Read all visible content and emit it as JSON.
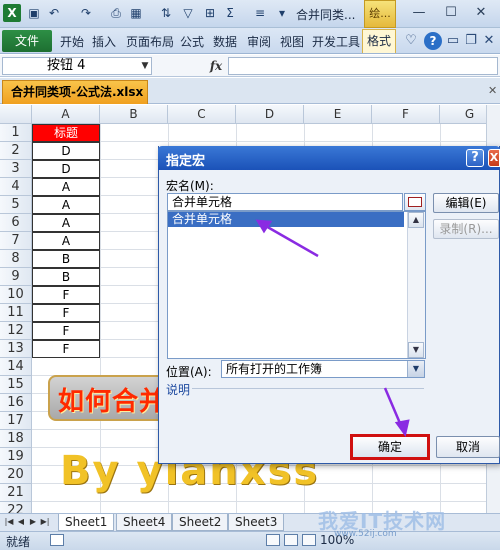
{
  "title_bar": {
    "app_icon": "X",
    "title": "合并同类...",
    "context_tab_title": "绘...",
    "quick_access_icons": [
      "save-icon",
      "undo-icon",
      "redo-icon",
      "print-preview-icon",
      "form-icon",
      "sort-icon",
      "border-icon",
      "sum-icon",
      "align-icon"
    ]
  },
  "ribbon": {
    "file_tab": "文件",
    "tabs": [
      "开始",
      "插入",
      "页面布局",
      "公式",
      "数据",
      "审阅",
      "视图",
      "开发工具"
    ],
    "context_tab": "格式"
  },
  "formula_bar": {
    "name_box": "按钮 4",
    "fx": "fx",
    "formula": ""
  },
  "workbook": {
    "tab_label": "合并同类项-公式法.xlsx"
  },
  "grid": {
    "columns": [
      "A",
      "B",
      "C",
      "D",
      "E",
      "F",
      "G"
    ],
    "rows": [
      "1",
      "2",
      "3",
      "4",
      "5",
      "6",
      "7",
      "8",
      "9",
      "10",
      "11",
      "12",
      "13",
      "14",
      "15",
      "16",
      "17",
      "18",
      "19",
      "20",
      "21",
      "22"
    ],
    "col_a_values": [
      "标题",
      "D",
      "D",
      "A",
      "A",
      "A",
      "A",
      "B",
      "B",
      "F",
      "F",
      "F",
      "F"
    ]
  },
  "shapes": {
    "shape1_text": "如何合并",
    "shape2_text": "By yianxss"
  },
  "sheets": {
    "tabs": [
      "Sheet1",
      "Sheet4",
      "Sheet2",
      "Sheet3"
    ]
  },
  "status": {
    "ready": "就绪",
    "zoom": "100%",
    "watermark": "我爱IT技术网",
    "watermark_sub": "www.52ij.com"
  },
  "dialog": {
    "title": "指定宏",
    "help": "?",
    "close": "X",
    "macro_name_label": "宏名(M):",
    "macro_name_value": "合并单元格",
    "macro_list": [
      "合并单元格"
    ],
    "edit_button": "编辑(E)",
    "record_button": "录制(R)...",
    "location_label": "位置(A):",
    "location_value": "所有打开的工作簿",
    "description_label": "说明",
    "ok_button": "确定",
    "cancel_button": "取消"
  },
  "colors": {
    "header_cell_bg": "#ff0000",
    "dialog_title_bg": "#1b52b8",
    "selection_bg": "#3a6ec3",
    "highlight_border": "#d01010",
    "annotation_arrow": "#8a2be2",
    "workbook_tab": "#f0a020"
  }
}
